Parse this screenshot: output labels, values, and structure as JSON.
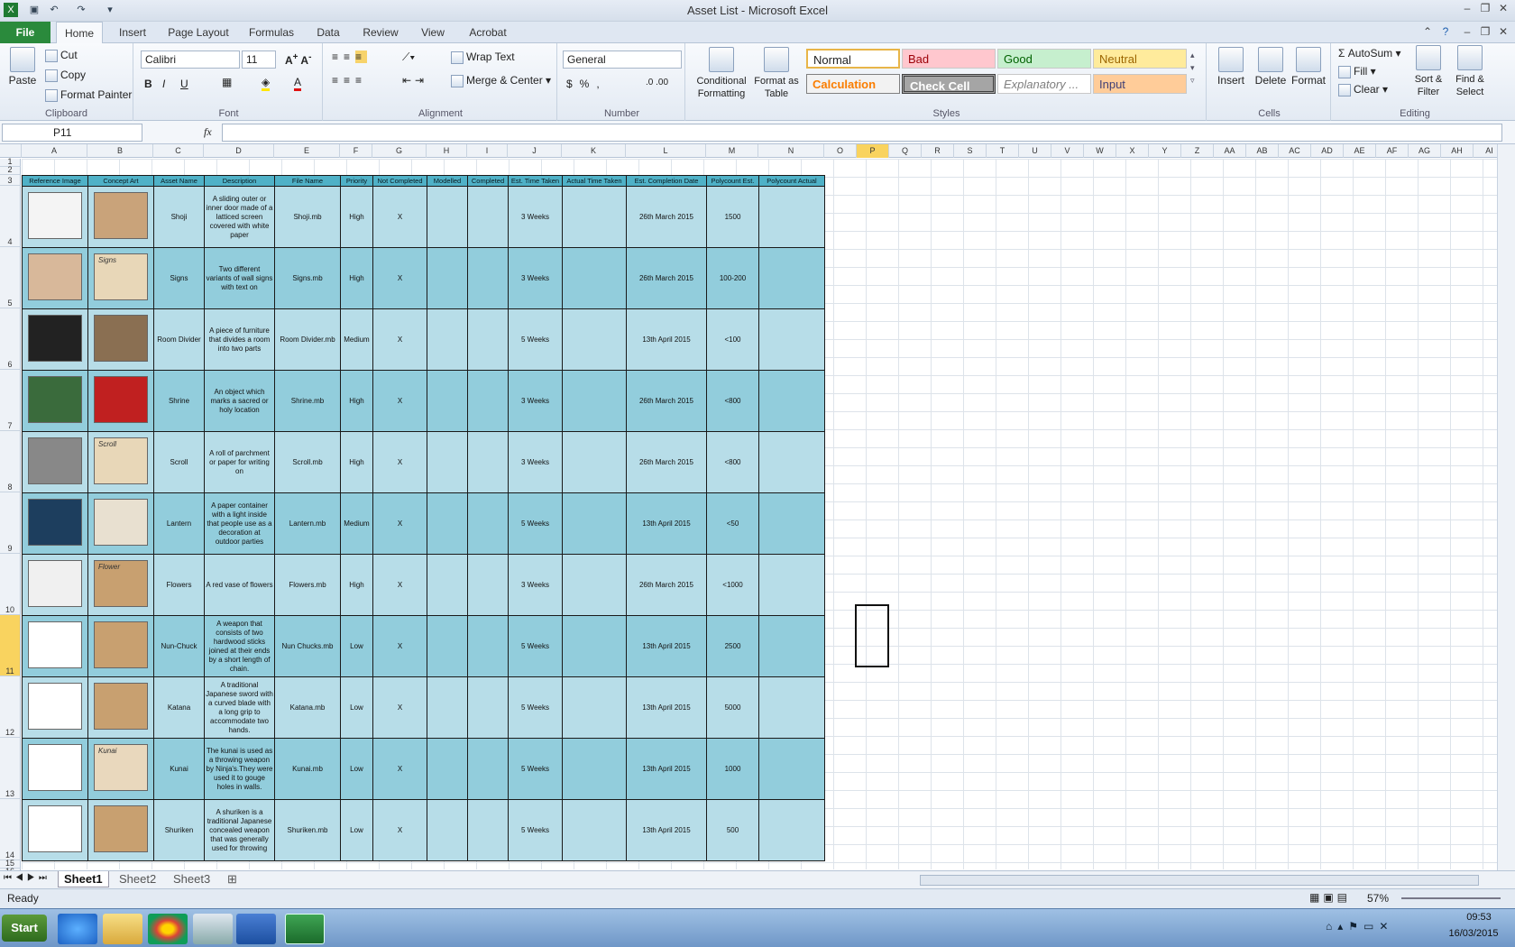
{
  "window": {
    "title": "Asset List - Microsoft Excel"
  },
  "tabs": [
    "File",
    "Home",
    "Insert",
    "Page Layout",
    "Formulas",
    "Data",
    "Review",
    "View",
    "Acrobat"
  ],
  "ribbon": {
    "clipboard": {
      "paste": "Paste",
      "cut": "Cut",
      "copy": "Copy",
      "format_painter": "Format Painter",
      "label": "Clipboard"
    },
    "font": {
      "name": "Calibri",
      "size": "11",
      "label": "Font"
    },
    "alignment": {
      "wrap_text": "Wrap Text",
      "merge_center": "Merge & Center",
      "label": "Alignment"
    },
    "number": {
      "format": "General",
      "label": "Number"
    },
    "styles": {
      "conditional": "Conditional Formatting",
      "format_table": "Format as Table",
      "normal": "Normal",
      "bad": "Bad",
      "good": "Good",
      "neutral": "Neutral",
      "calculation": "Calculation",
      "check_cell": "Check Cell",
      "explanatory": "Explanatory ...",
      "input": "Input",
      "label": "Styles"
    },
    "cells": {
      "insert": "Insert",
      "delete": "Delete",
      "format": "Format",
      "label": "Cells"
    },
    "editing": {
      "autosum": "AutoSum",
      "fill": "Fill",
      "clear": "Clear",
      "sort_filter": "Sort & Filter",
      "find_select": "Find & Select",
      "label": "Editing"
    }
  },
  "formula_bar": {
    "name_box": "P11",
    "fx": "fx",
    "value": ""
  },
  "columns": [
    "A",
    "B",
    "C",
    "D",
    "E",
    "F",
    "G",
    "H",
    "I",
    "J",
    "K",
    "L",
    "M",
    "N",
    "O",
    "P",
    "Q",
    "R",
    "S",
    "T",
    "U",
    "V",
    "W",
    "X",
    "Y",
    "Z",
    "AA",
    "AB",
    "AC",
    "AD",
    "AE",
    "AF",
    "AG",
    "AH",
    "AI"
  ],
  "rows": [
    "1",
    "2",
    "3",
    "4",
    "5",
    "6",
    "7",
    "8",
    "9",
    "10",
    "11",
    "12",
    "13",
    "14",
    "15",
    "16"
  ],
  "table": {
    "headers": [
      "Reference Image",
      "Concept Art",
      "Asset Name",
      "Description",
      "File Name",
      "Priority",
      "Not Completed",
      "Modelled",
      "Completed",
      "Est. Time Taken",
      "Actual Time Taken",
      "Est. Completion Date",
      "Polycount Est.",
      "Polycount Actual"
    ],
    "rows": [
      {
        "name": "Shoji",
        "desc": "A sliding outer or inner door made of a latticed screen covered with white paper",
        "file": "Shoji.mb",
        "priority": "High",
        "not_completed": "X",
        "est_time": "3 Weeks",
        "date": "26th March 2015",
        "poly": "1500",
        "concept_label": ""
      },
      {
        "name": "Signs",
        "desc": "Two different variants of wall signs with text on",
        "file": "Signs.mb",
        "priority": "High",
        "not_completed": "X",
        "est_time": "3 Weeks",
        "date": "26th March 2015",
        "poly": "100-200",
        "concept_label": "Signs"
      },
      {
        "name": "Room Divider",
        "desc": "A piece of furniture that divides a room into two parts",
        "file": "Room Divider.mb",
        "priority": "Medium",
        "not_completed": "X",
        "est_time": "5 Weeks",
        "date": "13th April 2015",
        "poly": "<100",
        "concept_label": ""
      },
      {
        "name": "Shrine",
        "desc": "An object which marks a sacred or holy location",
        "file": "Shrine.mb",
        "priority": "High",
        "not_completed": "X",
        "est_time": "3 Weeks",
        "date": "26th March 2015",
        "poly": "<800",
        "concept_label": ""
      },
      {
        "name": "Scroll",
        "desc": "A roll of parchment or paper for writing on",
        "file": "Scroll.mb",
        "priority": "High",
        "not_completed": "X",
        "est_time": "3 Weeks",
        "date": "26th March 2015",
        "poly": "<800",
        "concept_label": "Scroll"
      },
      {
        "name": "Lantern",
        "desc": "A paper container with a light inside that people use as a decoration at outdoor parties",
        "file": "Lantern.mb",
        "priority": "Medium",
        "not_completed": "X",
        "est_time": "5 Weeks",
        "date": "13th April 2015",
        "poly": "<50",
        "concept_label": ""
      },
      {
        "name": "Flowers",
        "desc": "A red vase of flowers",
        "file": "Flowers.mb",
        "priority": "High",
        "not_completed": "X",
        "est_time": "3 Weeks",
        "date": "26th March 2015",
        "poly": "<1000",
        "concept_label": "Flower"
      },
      {
        "name": "Nun-Chuck",
        "desc": "A weapon that consists of two hardwood sticks joined at their ends by a short length of chain.",
        "file": "Nun Chucks.mb",
        "priority": "Low",
        "not_completed": "X",
        "est_time": "5 Weeks",
        "date": "13th April 2015",
        "poly": "2500",
        "concept_label": ""
      },
      {
        "name": "Katana",
        "desc": "A traditional Japanese sword with a curved blade with a long grip to accommodate two hands.",
        "file": "Katana.mb",
        "priority": "Low",
        "not_completed": "X",
        "est_time": "5 Weeks",
        "date": "13th April 2015",
        "poly": "5000",
        "concept_label": ""
      },
      {
        "name": "Kunai",
        "desc": "The kunai is used as a throwing weapon by Ninja's.They were used it to gouge holes in walls.",
        "file": "Kunai.mb",
        "priority": "Low",
        "not_completed": "X",
        "est_time": "5 Weeks",
        "date": "13th April 2015",
        "poly": "1000",
        "concept_label": "Kunai"
      },
      {
        "name": "Shuriken",
        "desc": "A shuriken is a traditional Japanese concealed weapon that was generally used for throwing",
        "file": "Shuriken.mb",
        "priority": "Low",
        "not_completed": "X",
        "est_time": "5 Weeks",
        "date": "13th April 2015",
        "poly": "500",
        "concept_label": ""
      }
    ]
  },
  "sheets": [
    "Sheet1",
    "Sheet2",
    "Sheet3"
  ],
  "status": {
    "text": "Ready",
    "zoom": "57%"
  },
  "taskbar": {
    "start": "Start",
    "time": "09:53",
    "date": "16/03/2015"
  },
  "colors": {
    "header": "#4fb1c7",
    "row_light": "#b7dde8",
    "row_dark": "#92cddc",
    "file_tab": "#2a8a3c"
  }
}
